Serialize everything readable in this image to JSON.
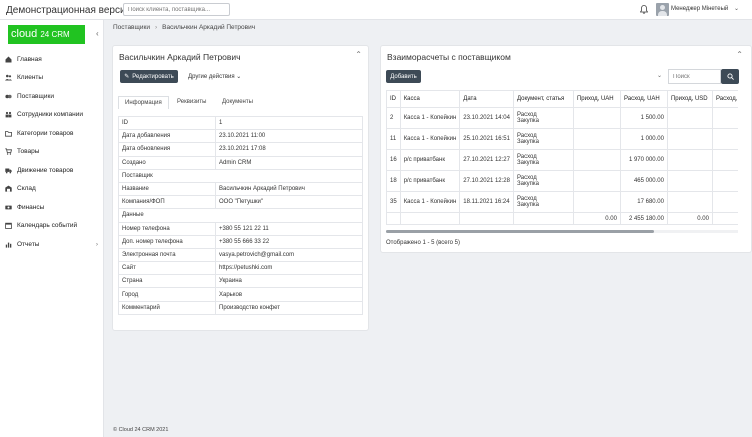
{
  "app_title": "Демонстрационная версия",
  "search": {
    "placeholder": "Поиск клиента, поставщика..."
  },
  "user": {
    "name": "Менеджер Мінетеый"
  },
  "logo": {
    "text": "cloud",
    "suffix": "24 CRM"
  },
  "sidebar": {
    "items": [
      {
        "label": "Главная",
        "icon": "home-icon"
      },
      {
        "label": "Клиенты",
        "icon": "users-icon"
      },
      {
        "label": "Поставщики",
        "icon": "supplier-icon"
      },
      {
        "label": "Сотрудники компании",
        "icon": "team-icon"
      },
      {
        "label": "Категории товаров",
        "icon": "folder-icon"
      },
      {
        "label": "Товары",
        "icon": "cart-icon"
      },
      {
        "label": "Движение товаров",
        "icon": "truck-icon"
      },
      {
        "label": "Склад",
        "icon": "warehouse-icon"
      },
      {
        "label": "Финансы",
        "icon": "money-icon"
      },
      {
        "label": "Календарь событий",
        "icon": "calendar-icon"
      },
      {
        "label": "Отчеты",
        "icon": "chart-icon",
        "has_arrow": true
      }
    ]
  },
  "breadcrumbs": {
    "root": "Поставщики",
    "sep": "›",
    "current": "Васильчкин Аркадий Петрович"
  },
  "supplier_panel": {
    "title": "Васильчкин Аркадий Петрович",
    "edit_label": "Редактировать",
    "other_label": "Другие действия",
    "tabs": [
      "Информация",
      "Реквизиты",
      "Документы"
    ],
    "rows": [
      {
        "label": "ID",
        "value": "1"
      },
      {
        "label": "Дата добавления",
        "value": "23.10.2021 11:00"
      },
      {
        "label": "Дата обновления",
        "value": "23.10.2021 17:08"
      },
      {
        "label": "Создано",
        "value": "Admin CRM"
      },
      {
        "section": "Поставщик"
      },
      {
        "label": "Название",
        "value": "Васильчкин Аркадий Петрович"
      },
      {
        "label": "Компания/ФОП",
        "value": "ООО \"Петушки\""
      },
      {
        "section": "Данные"
      },
      {
        "label": "Номер телефона",
        "value": "+380 55 121 22 11"
      },
      {
        "label": "Доп. номер телефона",
        "value": "+380 55 666 33 22"
      },
      {
        "label": "Электронная почта",
        "value": "vasya.petrovich@gmail.com"
      },
      {
        "label": "Сайт",
        "value": "https://petushki.com"
      },
      {
        "label": "Страна",
        "value": "Украина"
      },
      {
        "label": "Город",
        "value": "Харьков"
      },
      {
        "label": "Комментарий",
        "value": "Производство конфет"
      }
    ]
  },
  "settlements": {
    "title": "Взаиморасчеты с поставщиком",
    "add_label": "Добавить",
    "search_placeholder": "Поиск",
    "columns": [
      "ID",
      "Касса",
      "Дата",
      "Документ, статья",
      "Приход, UAH",
      "Расход, UAH",
      "Приход, USD",
      "Расход, U"
    ],
    "rows": [
      {
        "id": "2",
        "kassa": "Касса 1 - Копейкин",
        "date": "23.10.2021 14:04",
        "doc1": "Расход",
        "doc2": "Закупка",
        "in_uah": "",
        "out_uah": "1 500.00",
        "in_usd": "",
        "out_usd": ""
      },
      {
        "id": "11",
        "kassa": "Касса 1 - Копейкин",
        "date": "25.10.2021 16:51",
        "doc1": "Расход",
        "doc2": "Закупка",
        "in_uah": "",
        "out_uah": "1 000.00",
        "in_usd": "",
        "out_usd": ""
      },
      {
        "id": "16",
        "kassa": "р/с приватбанк",
        "date": "27.10.2021 12:27",
        "doc1": "Расход",
        "doc2": "Закупка",
        "in_uah": "",
        "out_uah": "1 970 000.00",
        "in_usd": "",
        "out_usd": ""
      },
      {
        "id": "18",
        "kassa": "р/с приватбанк",
        "date": "27.10.2021 12:28",
        "doc1": "Расход",
        "doc2": "Закупка",
        "in_uah": "",
        "out_uah": "465 000.00",
        "in_usd": "",
        "out_usd": ""
      },
      {
        "id": "35",
        "kassa": "Касса 1 - Копейкин",
        "date": "18.11.2021 16:24",
        "doc1": "Расход",
        "doc2": "Закупка",
        "in_uah": "",
        "out_uah": "17 680.00",
        "in_usd": "",
        "out_usd": ""
      }
    ],
    "totals": {
      "in_uah": "0.00",
      "out_uah": "2 455 180.00",
      "in_usd": "0.00",
      "out_usd": "("
    },
    "summary": "Отображено 1 - 5 (всего 5)"
  },
  "footer": "© Cloud 24 CRM 2021"
}
